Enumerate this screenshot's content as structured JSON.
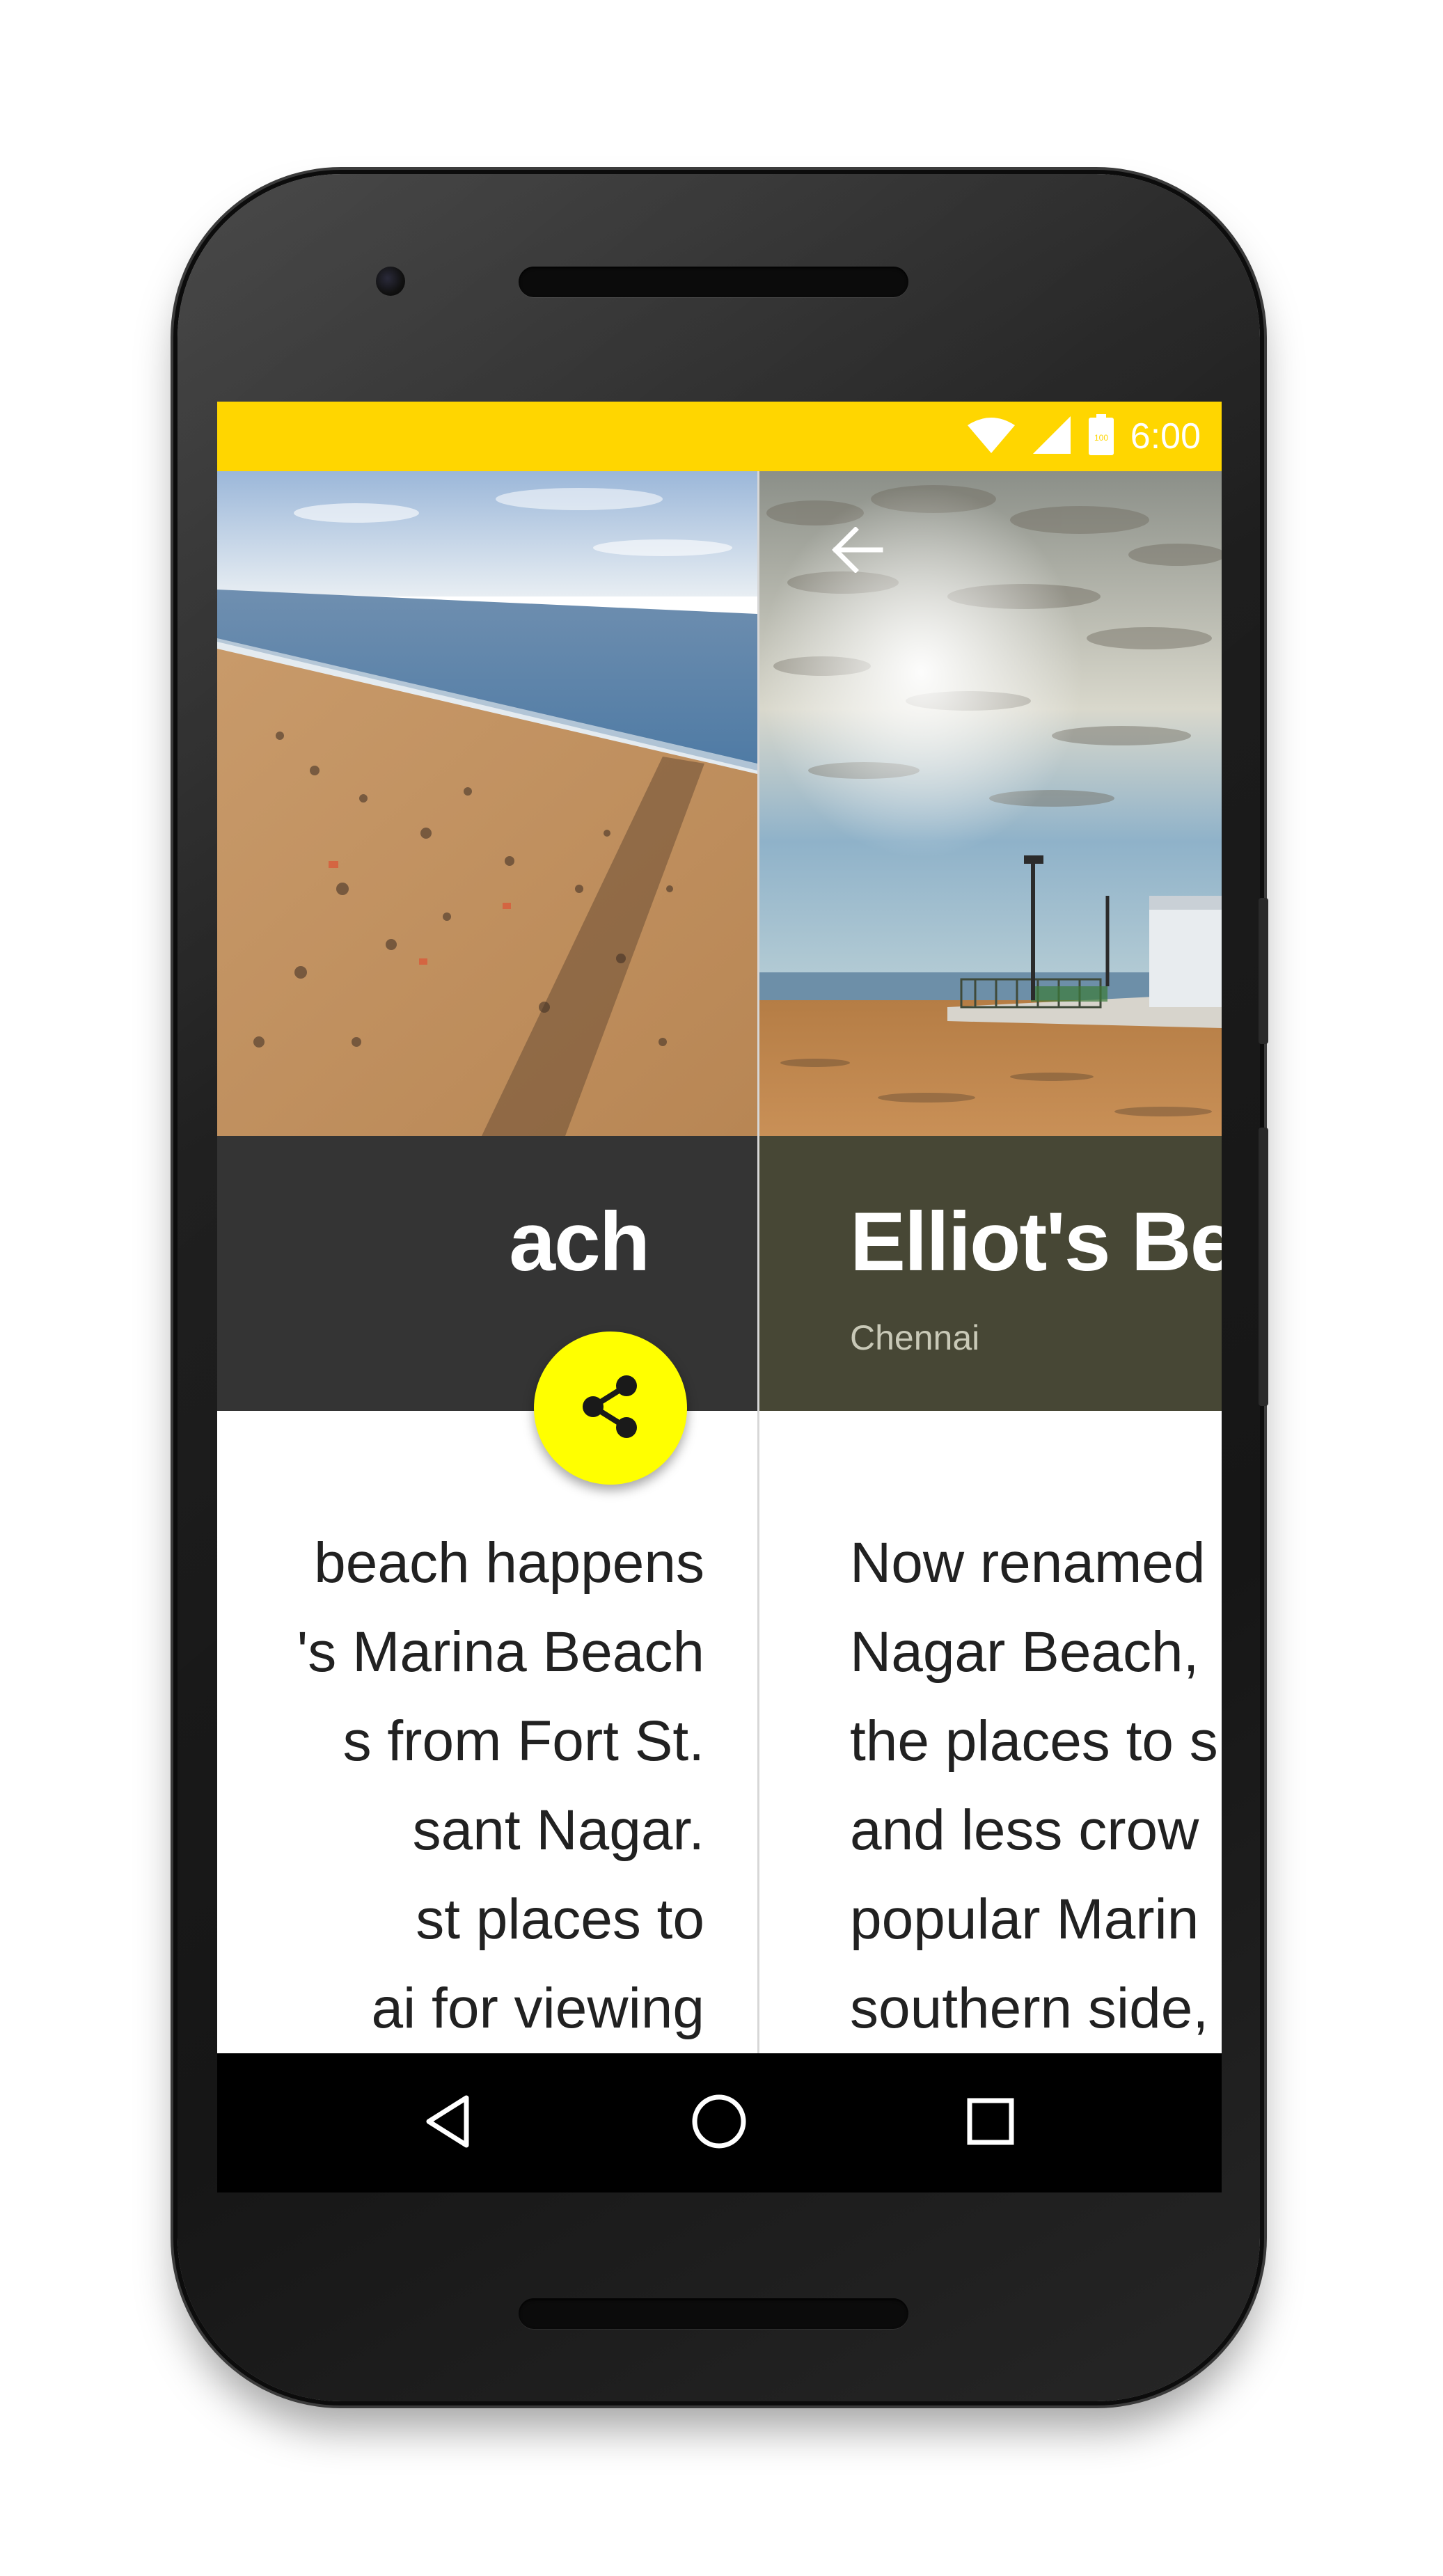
{
  "status_bar": {
    "time": "6:00",
    "battery_level": "100",
    "color": "#ffd600"
  },
  "left_card": {
    "title": "ach",
    "body_lines": [
      "beach happens",
      "'s Marina Beach",
      "s from Fort St.",
      "sant Nagar.",
      "st places to",
      "ai for viewing"
    ],
    "header_color": "#343434"
  },
  "right_card": {
    "title": "Elliot's Bea",
    "subtitle": "Chennai",
    "body_lines": [
      "Now renamed",
      "Nagar Beach,",
      "the places to s",
      "and less crow",
      "popular Marin",
      "southern side,"
    ],
    "header_color": "#474735"
  },
  "fab": {
    "icon": "share-icon",
    "color": "#ffff00"
  },
  "top_actions": {
    "back_icon": "arrow-back-icon"
  },
  "nav_bar": {
    "icons": [
      "back-triangle-icon",
      "home-circle-icon",
      "recents-square-icon"
    ]
  }
}
